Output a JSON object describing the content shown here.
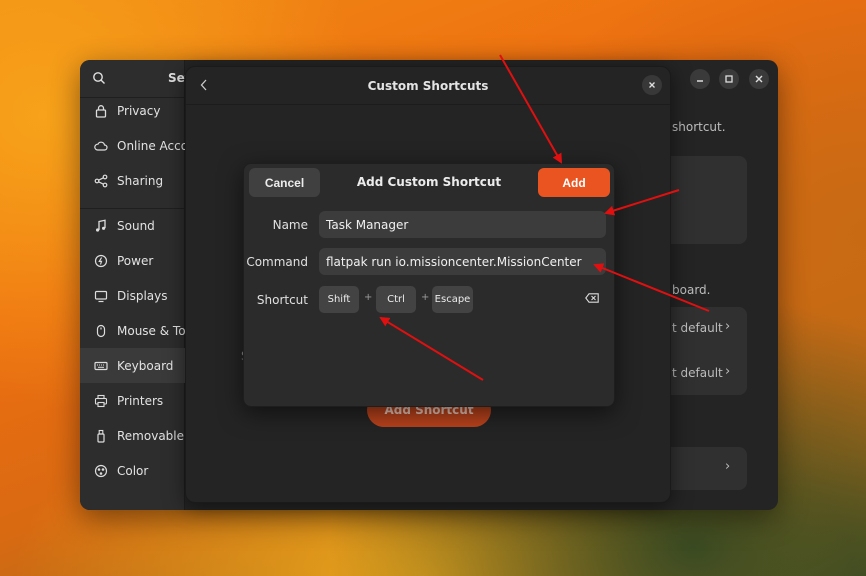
{
  "sidebar": {
    "title": "Set",
    "items": [
      {
        "label": "Privacy",
        "icon": "lock-icon"
      },
      {
        "label": "Online Accou",
        "icon": "cloud-icon"
      },
      {
        "label": "Sharing",
        "icon": "share-icon"
      },
      {
        "label": "Sound",
        "icon": "music-note-icon"
      },
      {
        "label": "Power",
        "icon": "power-icon"
      },
      {
        "label": "Displays",
        "icon": "monitor-icon"
      },
      {
        "label": "Mouse & Tou",
        "icon": "mouse-icon"
      },
      {
        "label": "Keyboard",
        "icon": "keyboard-icon"
      },
      {
        "label": "Printers",
        "icon": "printer-icon"
      },
      {
        "label": "Removable M",
        "icon": "usb-icon"
      },
      {
        "label": "Color",
        "icon": "color-palette-icon"
      }
    ]
  },
  "background_settings": {
    "hint_text": "shortcut.",
    "hint_text_2": "board.",
    "reset_1": "t default",
    "reset_2": "t default",
    "chevron": "›"
  },
  "custom_shortcuts_dialog": {
    "title": "Custom Shortcuts",
    "add_shortcut_label": "Add Shortcut",
    "partial_text": "S"
  },
  "add_custom_shortcut_dialog": {
    "title": "Add Custom Shortcut",
    "cancel_label": "Cancel",
    "add_label": "Add",
    "name_label": "Name",
    "name_value": "Task Manager",
    "command_label": "Command",
    "command_value": "flatpak run io.missioncenter.MissionCenter",
    "shortcut_label": "Shortcut",
    "keys": [
      "Shift",
      "Ctrl",
      "Escape"
    ],
    "key_separator": "+"
  },
  "colors": {
    "accent": "#e95420",
    "annotation_arrow": "#e01010"
  }
}
